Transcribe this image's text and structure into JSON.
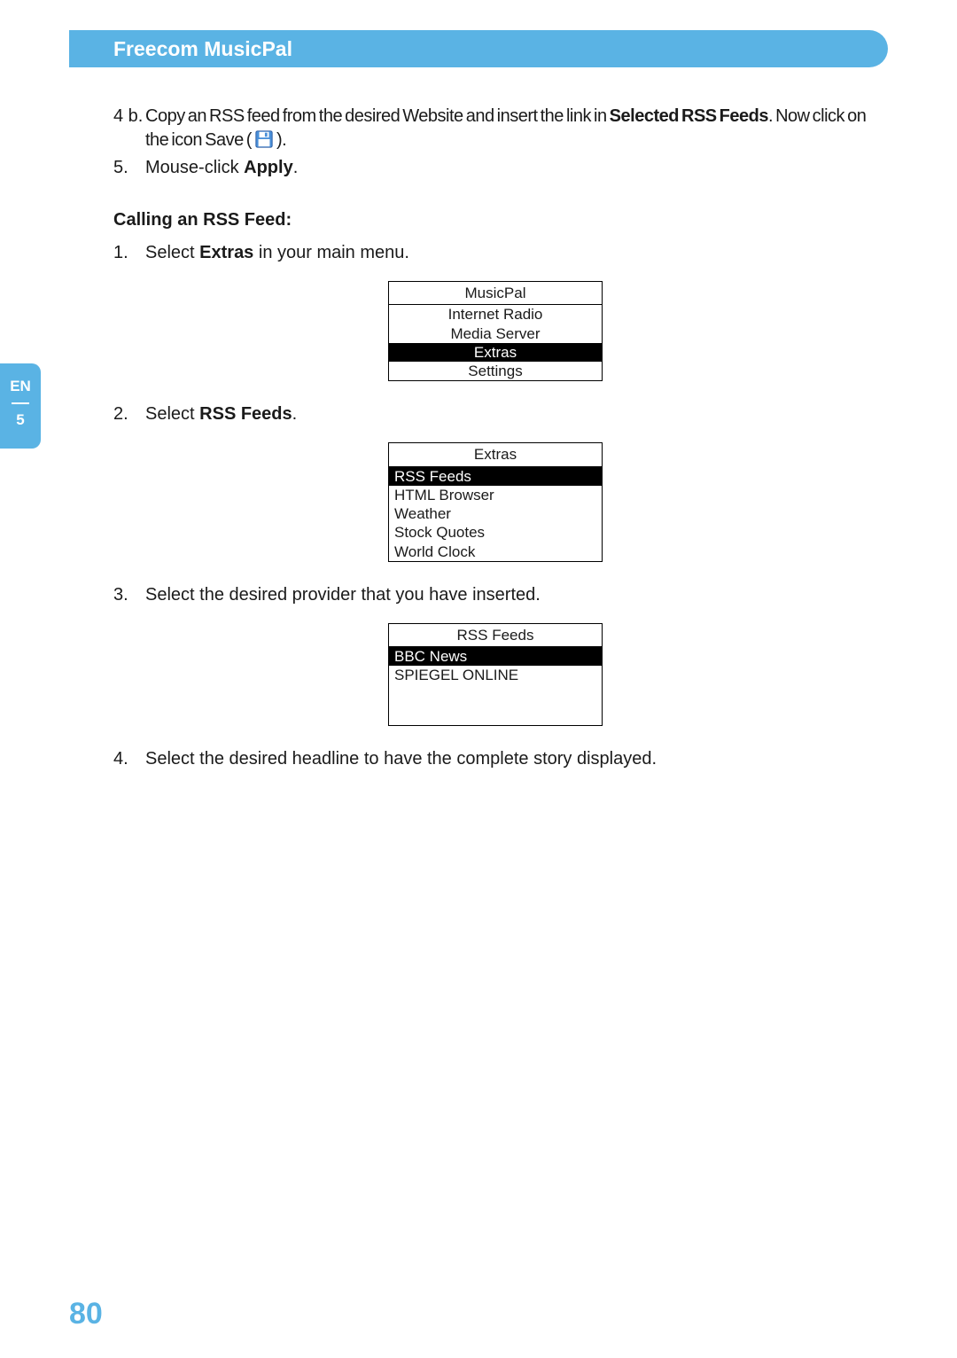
{
  "header": {
    "title": "Freecom MusicPal"
  },
  "sidetab": {
    "lang": "EN",
    "chapter": "5"
  },
  "page_number": "80",
  "steps": {
    "s4b_num": "4 b.",
    "s4b_a": "Copy an RSS feed from the desired Website and insert the link in ",
    "s4b_bold": "Selected RSS Feeds",
    "s4b_b": ". Now click on the icon Save ( ",
    "s4b_c": " ).",
    "s5_num": "5.",
    "s5_a": "Mouse-click ",
    "s5_bold": "Apply",
    "s5_b": ".",
    "heading": "Calling an RSS Feed:",
    "c1_num": "1.",
    "c1_a": "Select ",
    "c1_bold": "Extras",
    "c1_b": " in your main menu.",
    "c2_num": "2.",
    "c2_a": "Select ",
    "c2_bold": "RSS Feeds",
    "c2_b": ".",
    "c3_num": "3.",
    "c3_txt": "Select the desired provider that you have inserted.",
    "c4_num": "4.",
    "c4_txt": "Select the desired headline to have the complete story displayed."
  },
  "menu1": {
    "title": "MusicPal",
    "items": [
      "Internet Radio",
      "Media Server",
      "Extras",
      "Settings"
    ],
    "selected": 2
  },
  "menu2": {
    "title": "Extras",
    "items": [
      "RSS Feeds",
      "HTML Browser",
      "Weather",
      "Stock Quotes",
      "World Clock"
    ],
    "selected": 0
  },
  "menu3": {
    "title": "RSS Feeds",
    "items": [
      "BBC News",
      "SPIEGEL ONLINE"
    ],
    "selected": 0
  }
}
